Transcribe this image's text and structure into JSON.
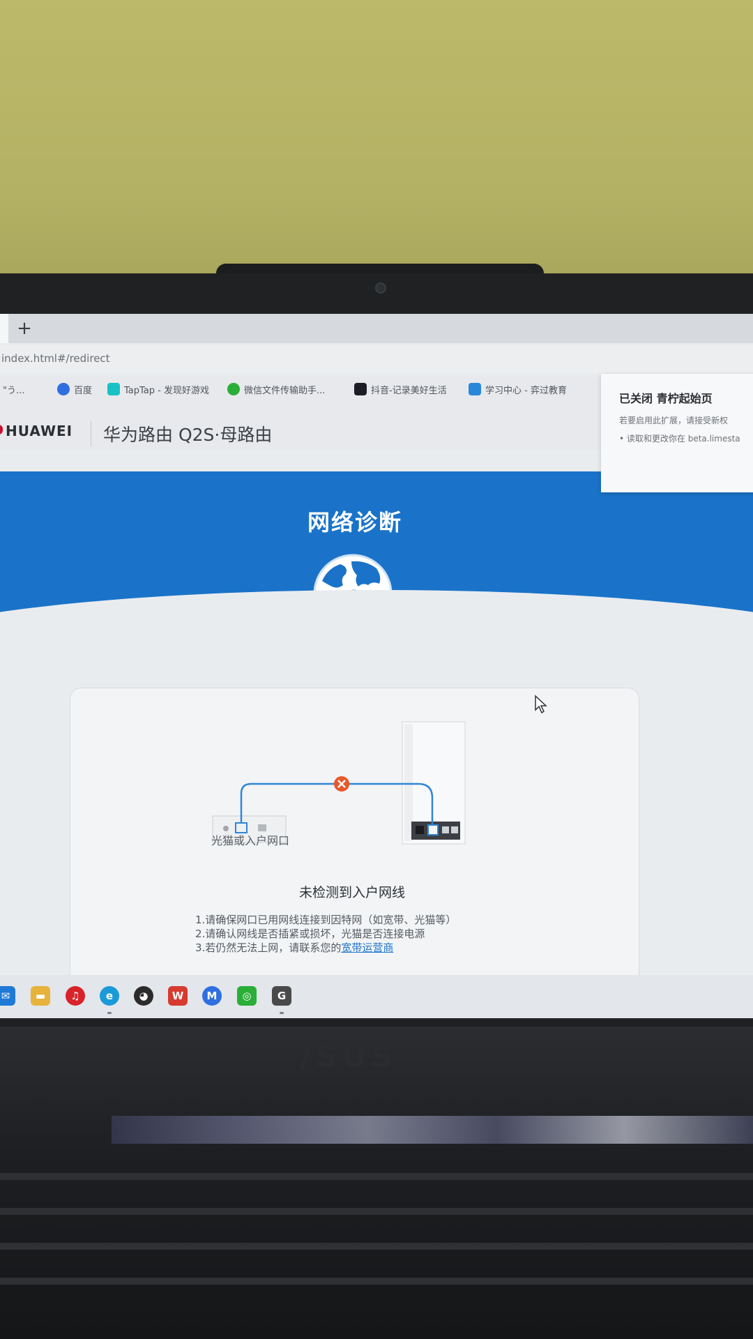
{
  "browser": {
    "new_tab_glyph": "+",
    "url": "index.html#/redirect",
    "bookmarks": [
      {
        "label": "\"う...",
        "icon": "bookmark-icon",
        "color": "#8c9096"
      },
      {
        "label": "百度",
        "icon": "baidu-icon",
        "color": "#2f6fe0"
      },
      {
        "label": "TapTap - 发现好游戏",
        "icon": "taptap-icon",
        "color": "#18c2c4"
      },
      {
        "label": "微信文件传输助手...",
        "icon": "wechat-icon",
        "color": "#2aae38"
      },
      {
        "label": "抖音-记录美好生活",
        "icon": "douyin-icon",
        "color": "#1d1d26"
      },
      {
        "label": "学习中心 - 弈过教育",
        "icon": "study-icon",
        "color": "#2a86d8"
      }
    ]
  },
  "header": {
    "logo": "HUAWEI",
    "product_title": "华为路由 Q2S·母路由"
  },
  "banner": {
    "title": "网络诊断",
    "color": "#1a73c9"
  },
  "extension_popup": {
    "title": "已关闭 青柠起始页",
    "line1": "若要启用此扩展，请接受新权",
    "line2": "• 读取和更改你在 beta.limesta"
  },
  "diagnosis": {
    "modem_label": "光猫或入户网口",
    "status_title": "未检测到入户网线",
    "tips": [
      "1.请确保网口已用网线连接到因特网（如宽带、光猫等）",
      "2.请确认网线是否插紧或损坏，光猫是否连接电源"
    ],
    "tip3_prefix": "3.若仍然无法上网，请联系您的",
    "tip3_link": "宽带运营商",
    "error_color": "#e8582a",
    "cable_color": "#2f86d6"
  },
  "laptop": {
    "brand": "/SUS"
  },
  "taskbar": {
    "apps": [
      {
        "name": "mail-icon",
        "glyph": "✉",
        "color": "#1f7ad6"
      },
      {
        "name": "file-explorer-icon",
        "glyph": "▬",
        "color": "#e8b33a"
      },
      {
        "name": "netease-music-icon",
        "glyph": "♫",
        "color": "#d8232a"
      },
      {
        "name": "edge-icon",
        "glyph": "e",
        "color": "#1a9ad9"
      },
      {
        "name": "qq-icon",
        "glyph": "◕",
        "color": "#2b2b2b"
      },
      {
        "name": "wps-icon",
        "glyph": "W",
        "color": "#d63b2f"
      },
      {
        "name": "lark-icon",
        "glyph": "M",
        "color": "#2f6fe0"
      },
      {
        "name": "wechat-taskbar-icon",
        "glyph": "◎",
        "color": "#2aae38"
      },
      {
        "name": "genshin-icon",
        "glyph": "G",
        "color": "#4a4a4a"
      }
    ]
  }
}
